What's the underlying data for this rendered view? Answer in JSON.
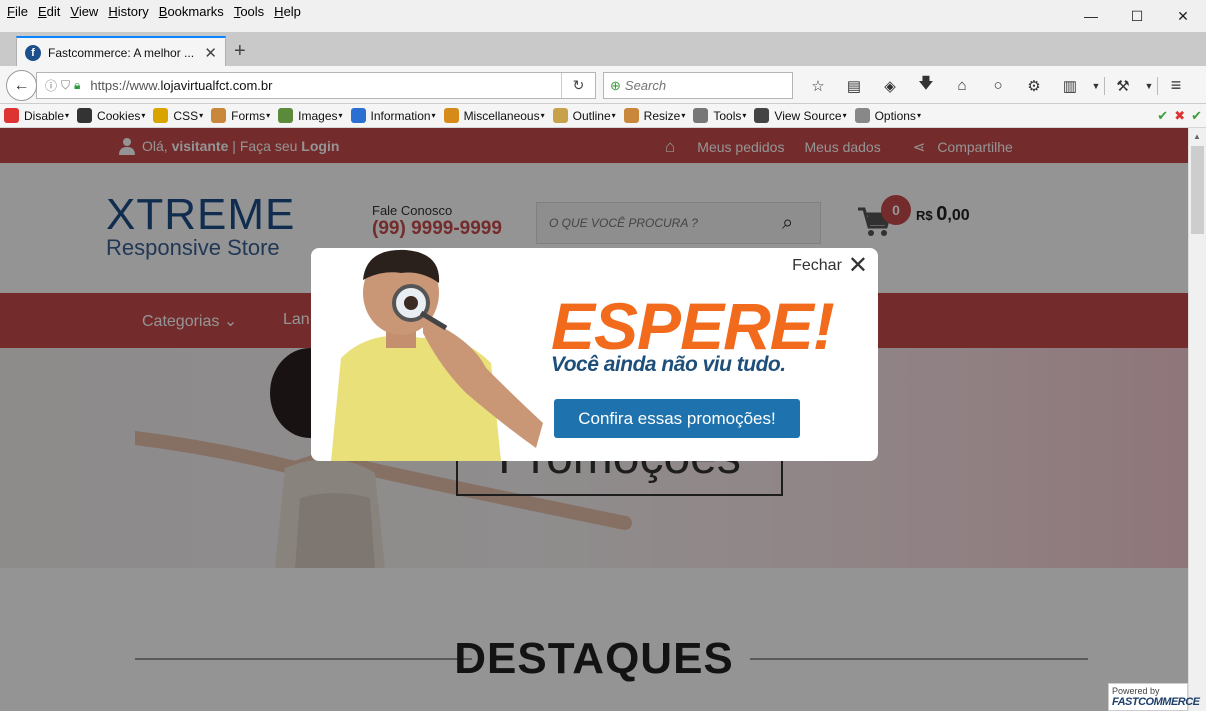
{
  "window": {
    "menubar": [
      {
        "underline": "F",
        "rest": "ile"
      },
      {
        "underline": "E",
        "rest": "dit"
      },
      {
        "underline": "V",
        "rest": "iew"
      },
      {
        "underline": "H",
        "rest": "istory"
      },
      {
        "underline": "B",
        "rest": "ookmarks"
      },
      {
        "underline": "T",
        "rest": "ools"
      },
      {
        "underline": "H",
        "rest": "elp"
      }
    ],
    "controls": {
      "minimize": "—",
      "maximize": "☐",
      "close": "✕"
    }
  },
  "tab": {
    "favicon": "f",
    "title": "Fastcommerce: A melhor ...",
    "close": "✕",
    "new_tab": "+"
  },
  "navigation": {
    "back": "←",
    "url_scheme": "https://www.",
    "url_host": "lojavirtualfct.com.br",
    "reload": "↻",
    "search_placeholder": "Search"
  },
  "toolbar_icons": [
    "star-icon",
    "reading-list-icon",
    "pocket-icon",
    "download-icon",
    "home-icon",
    "chat-icon",
    "extension-icon",
    "clipboard-icon",
    "dropdown-icon",
    "wrench-icon",
    "dropdown-icon"
  ],
  "web_developer_bar": [
    {
      "label": "Disable",
      "color": "#d33"
    },
    {
      "label": "Cookies",
      "color": "#333"
    },
    {
      "label": "CSS",
      "color": "#d9a400"
    },
    {
      "label": "Forms",
      "color": "#c8873a"
    },
    {
      "label": "Images",
      "color": "#5a8a3a"
    },
    {
      "label": "Information",
      "color": "#2a6fd1"
    },
    {
      "label": "Miscellaneous",
      "color": "#d68a1a"
    },
    {
      "label": "Outline",
      "color": "#c8a24a"
    },
    {
      "label": "Resize",
      "color": "#c8873a"
    },
    {
      "label": "Tools",
      "color": "#777"
    },
    {
      "label": "View Source",
      "color": "#444"
    },
    {
      "label": "Options",
      "color": "#888"
    }
  ],
  "site": {
    "topbar": {
      "greeting": "Olá,",
      "visitor": "visitante",
      "separator": "|",
      "login_prompt": "Faça seu",
      "login": "Login",
      "links": [
        "Meus pedidos",
        "Meus dados"
      ],
      "share": "Compartilhe"
    },
    "logo": {
      "line1": "XTREME",
      "line2": "Responsive Store"
    },
    "contact": {
      "label": "Fale Conosco",
      "phone": "(99) 9999-9999"
    },
    "search_placeholder": "O QUE VOCÊ PROCURA ?",
    "cart": {
      "count": "0",
      "currency": "R$",
      "amount": "0",
      "cents": ",00"
    },
    "nav": {
      "categories": "Categorias",
      "partial": "Lan"
    },
    "banner_text": "Promoções",
    "section_title": "DESTAQUES"
  },
  "popup": {
    "close_label": "Fechar",
    "headline": "ESPERE!",
    "subheadline": "Você ainda não viu tudo.",
    "cta": "Confira essas promoções!"
  },
  "powered_by": {
    "label": "Powered by",
    "brand": "FASTCOMMERCE"
  },
  "colors": {
    "brand_red": "#c94a4a",
    "brand_blue": "#1d4f8a",
    "popup_orange": "#f26a1b",
    "cta_blue": "#1e73ae"
  }
}
